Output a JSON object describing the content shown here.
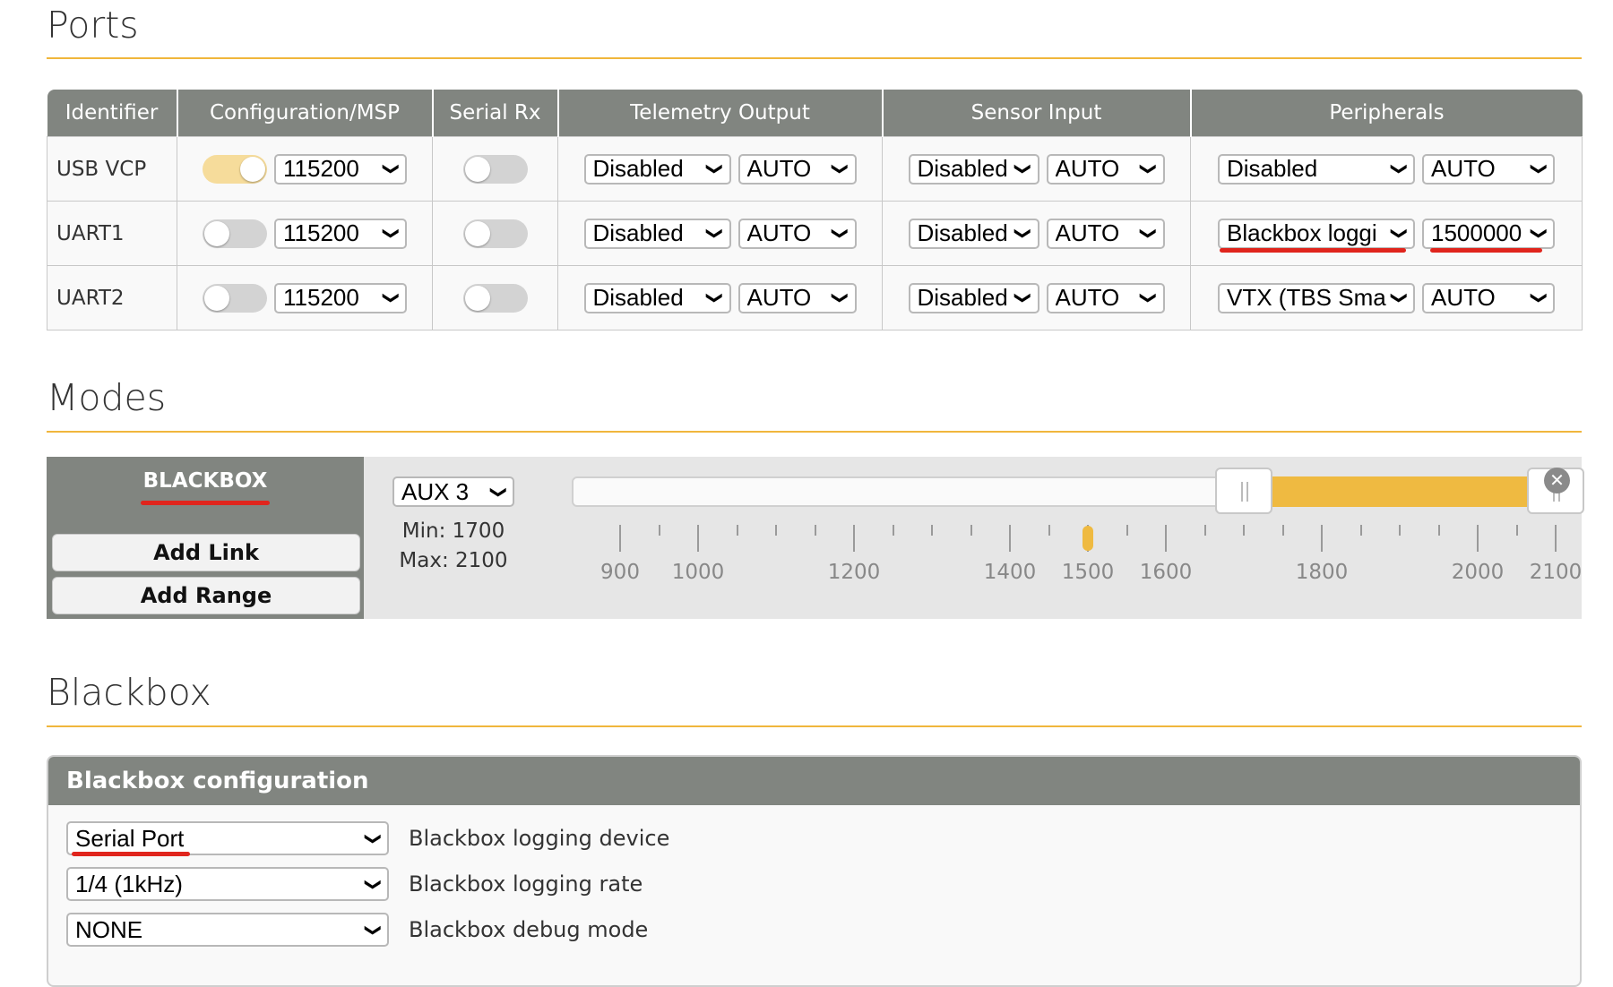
{
  "ports": {
    "title": "Ports",
    "headers": [
      "Identifier",
      "Configuration/MSP",
      "Serial Rx",
      "Telemetry Output",
      "Sensor Input",
      "Peripherals"
    ],
    "rows": [
      {
        "id": "USB VCP",
        "msp_on": true,
        "msp_baud": "115200",
        "serial_rx_on": false,
        "telemetry": "Disabled",
        "telemetry_baud": "AUTO",
        "sensor": "Disabled",
        "sensor_baud": "AUTO",
        "peripheral": "Disabled",
        "peripheral_baud": "AUTO"
      },
      {
        "id": "UART1",
        "msp_on": false,
        "msp_baud": "115200",
        "serial_rx_on": false,
        "telemetry": "Disabled",
        "telemetry_baud": "AUTO",
        "sensor": "Disabled",
        "sensor_baud": "AUTO",
        "peripheral": "Blackbox loggi",
        "peripheral_baud": "1500000"
      },
      {
        "id": "UART2",
        "msp_on": false,
        "msp_baud": "115200",
        "serial_rx_on": false,
        "telemetry": "Disabled",
        "telemetry_baud": "AUTO",
        "sensor": "Disabled",
        "sensor_baud": "AUTO",
        "peripheral": "VTX (TBS Sma",
        "peripheral_baud": "AUTO"
      }
    ]
  },
  "modes": {
    "title": "Modes",
    "mode_name": "BLACKBOX",
    "add_link_label": "Add Link",
    "add_range_label": "Add Range",
    "channel": "AUX 3",
    "min_label": "Min: 1700",
    "max_label": "Max: 2100",
    "range_min": 900,
    "range_max": 2100,
    "selected_min": 1700,
    "selected_max": 2100,
    "current_value": 1500,
    "major_ticks": [
      900,
      1000,
      1200,
      1400,
      1500,
      1600,
      1800,
      2000,
      2100
    ],
    "tick_labels": [
      "900",
      "1000",
      "1200",
      "1400",
      "1500",
      "1600",
      "1800",
      "2000",
      "2100"
    ],
    "close_icon": "close-circle-icon"
  },
  "blackbox": {
    "title": "Blackbox",
    "header": "Blackbox configuration",
    "device_value": "Serial Port",
    "device_label": "Blackbox logging device",
    "rate_value": "1/4 (1kHz)",
    "rate_label": "Blackbox logging rate",
    "debug_value": "NONE",
    "debug_label": "Blackbox debug mode"
  },
  "colors": {
    "accent": "#efba41",
    "header_gray": "#818580",
    "highlight_red": "#e0251d"
  }
}
